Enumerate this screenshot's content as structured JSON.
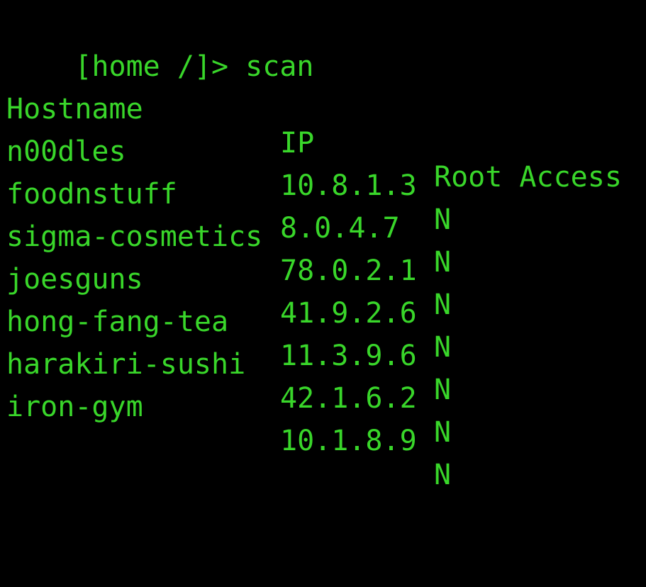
{
  "theme": {
    "background": "#000000",
    "text_color": "#39d62a"
  },
  "terminal": {
    "prompt": "[home /]>",
    "command": "scan"
  },
  "table": {
    "headers": {
      "hostname": "Hostname",
      "ip": "IP",
      "root_access": "Root Access"
    },
    "rows": [
      {
        "hostname": "n00dles",
        "ip": "10.8.1.3",
        "root_access": "N"
      },
      {
        "hostname": "foodnstuff",
        "ip": "8.0.4.7",
        "root_access": "N"
      },
      {
        "hostname": "sigma-cosmetics",
        "ip": "78.0.2.1",
        "root_access": "N"
      },
      {
        "hostname": "joesguns",
        "ip": "41.9.2.6",
        "root_access": "N"
      },
      {
        "hostname": "hong-fang-tea",
        "ip": "11.3.9.6",
        "root_access": "N"
      },
      {
        "hostname": "harakiri-sushi",
        "ip": "42.1.6.2",
        "root_access": "N"
      },
      {
        "hostname": "iron-gym",
        "ip": "10.1.8.9",
        "root_access": "N"
      }
    ]
  }
}
